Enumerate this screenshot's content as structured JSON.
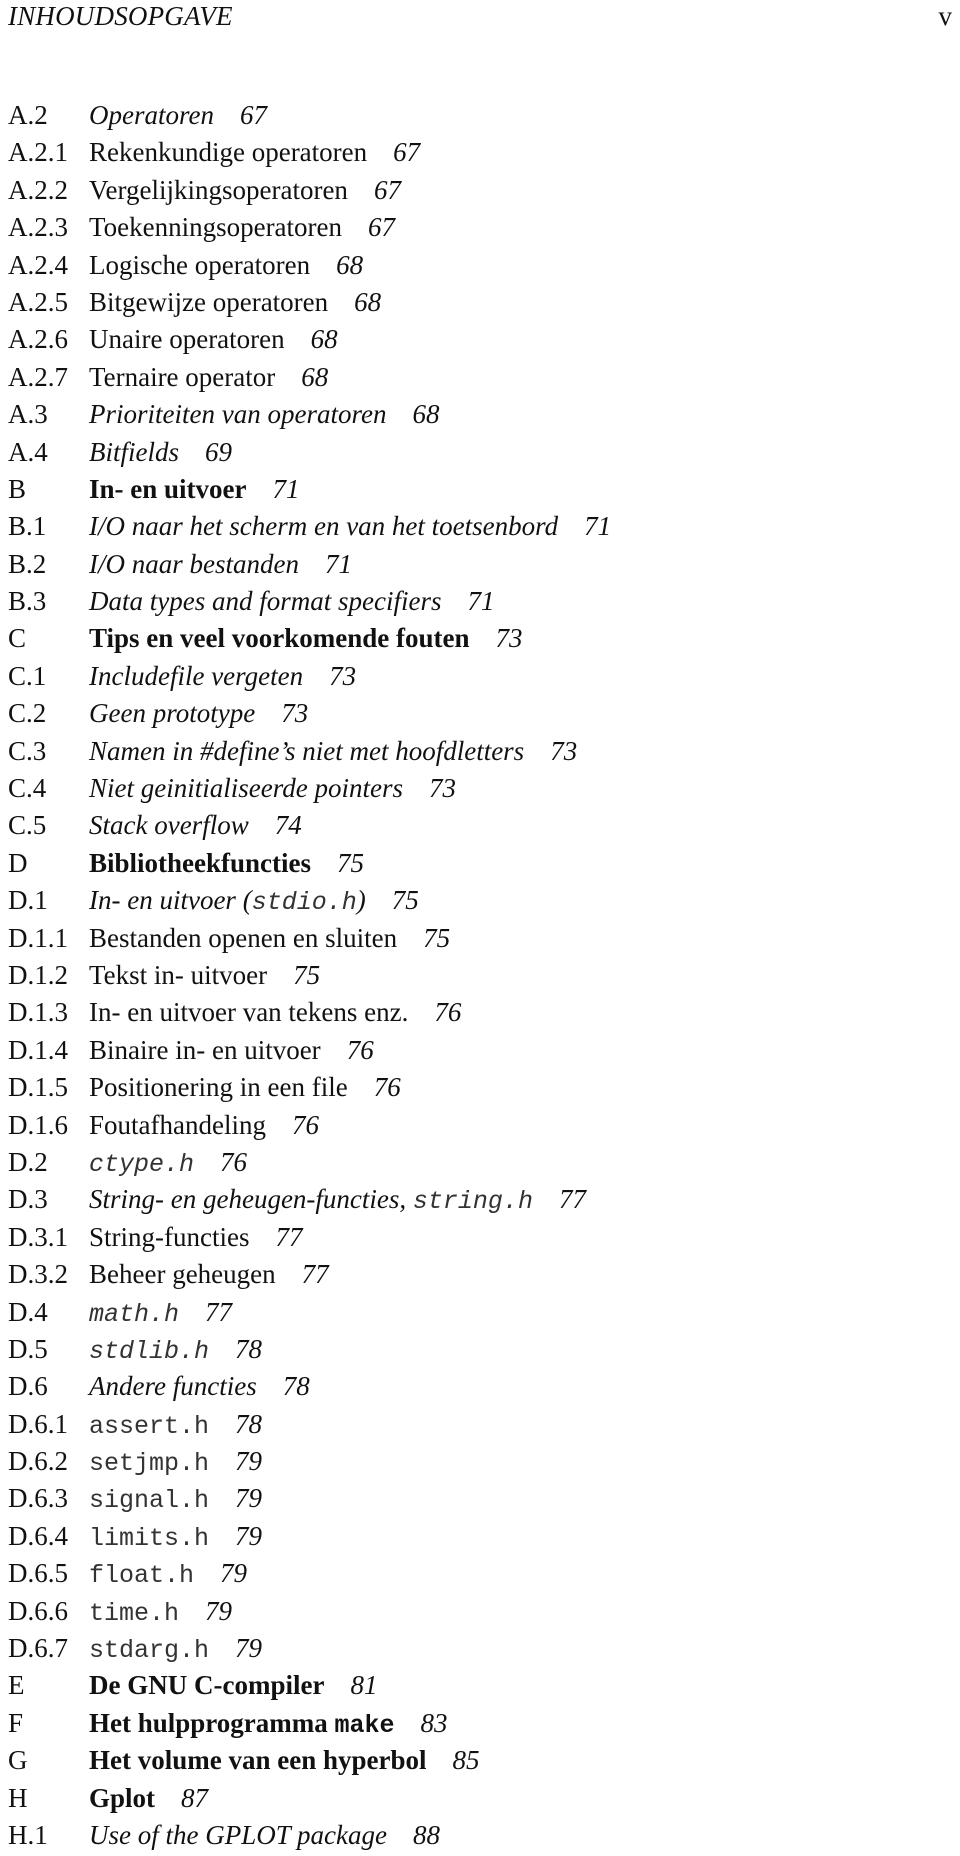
{
  "header": {
    "running_title": "INHOUDSOPGAVE",
    "page_number": "v"
  },
  "toc": [
    {
      "num": "A.2",
      "level": "section",
      "title": "Operatoren",
      "code": "",
      "suffix": "",
      "page": "67"
    },
    {
      "num": "A.2.1",
      "level": "subsection",
      "title": "Rekenkundige operatoren",
      "code": "",
      "suffix": "",
      "page": "67"
    },
    {
      "num": "A.2.2",
      "level": "subsection",
      "title": "Vergelijkingsoperatoren",
      "code": "",
      "suffix": "",
      "page": "67"
    },
    {
      "num": "A.2.3",
      "level": "subsection",
      "title": "Toekenningsoperatoren",
      "code": "",
      "suffix": "",
      "page": "67"
    },
    {
      "num": "A.2.4",
      "level": "subsection",
      "title": "Logische operatoren",
      "code": "",
      "suffix": "",
      "page": "68"
    },
    {
      "num": "A.2.5",
      "level": "subsection",
      "title": "Bitgewijze operatoren",
      "code": "",
      "suffix": "",
      "page": "68"
    },
    {
      "num": "A.2.6",
      "level": "subsection",
      "title": "Unaire operatoren",
      "code": "",
      "suffix": "",
      "page": "68"
    },
    {
      "num": "A.2.7",
      "level": "subsection",
      "title": "Ternaire operator",
      "code": "",
      "suffix": "",
      "page": "68"
    },
    {
      "num": "A.3",
      "level": "section",
      "title": "Prioriteiten van operatoren",
      "code": "",
      "suffix": "",
      "page": "68"
    },
    {
      "num": "A.4",
      "level": "section",
      "title": "Bitfields",
      "code": "",
      "suffix": "",
      "page": "69"
    },
    {
      "num": "B",
      "level": "chapter",
      "title": "In- en uitvoer",
      "code": "",
      "suffix": "",
      "page": "71"
    },
    {
      "num": "B.1",
      "level": "section",
      "title": "I/O naar het scherm en van het toetsenbord",
      "code": "",
      "suffix": "",
      "page": "71"
    },
    {
      "num": "B.2",
      "level": "section",
      "title": "I/O naar bestanden",
      "code": "",
      "suffix": "",
      "page": "71"
    },
    {
      "num": "B.3",
      "level": "section",
      "title": "Data types and format specifiers",
      "code": "",
      "suffix": "",
      "page": "71"
    },
    {
      "num": "C",
      "level": "chapter",
      "title": "Tips en veel voorkomende fouten",
      "code": "",
      "suffix": "",
      "page": "73"
    },
    {
      "num": "C.1",
      "level": "section",
      "title": "Includefile vergeten",
      "code": "",
      "suffix": "",
      "page": "73"
    },
    {
      "num": "C.2",
      "level": "section",
      "title": "Geen prototype",
      "code": "",
      "suffix": "",
      "page": "73"
    },
    {
      "num": "C.3",
      "level": "section",
      "title": "Namen in #define’s niet met hoofdletters",
      "code": "",
      "suffix": "",
      "page": "73"
    },
    {
      "num": "C.4",
      "level": "section",
      "title": "Niet geinitialiseerde pointers",
      "code": "",
      "suffix": "",
      "page": "73"
    },
    {
      "num": "C.5",
      "level": "section",
      "title": "Stack overflow",
      "code": "",
      "suffix": "",
      "page": "74"
    },
    {
      "num": "D",
      "level": "chapter",
      "title": "Bibliotheekfuncties",
      "code": "",
      "suffix": "",
      "page": "75"
    },
    {
      "num": "D.1",
      "level": "section",
      "title": "In- en uitvoer (",
      "code": "stdio.h",
      "suffix": ")",
      "page": "75"
    },
    {
      "num": "D.1.1",
      "level": "subsection",
      "title": "Bestanden openen en sluiten",
      "code": "",
      "suffix": "",
      "page": "75"
    },
    {
      "num": "D.1.2",
      "level": "subsection",
      "title": "Tekst in- uitvoer",
      "code": "",
      "suffix": "",
      "page": "75"
    },
    {
      "num": "D.1.3",
      "level": "subsection",
      "title": "In- en uitvoer van tekens enz.",
      "code": "",
      "suffix": "",
      "page": "76"
    },
    {
      "num": "D.1.4",
      "level": "subsection",
      "title": "Binaire in- en uitvoer",
      "code": "",
      "suffix": "",
      "page": "76"
    },
    {
      "num": "D.1.5",
      "level": "subsection",
      "title": "Positionering in een file",
      "code": "",
      "suffix": "",
      "page": "76"
    },
    {
      "num": "D.1.6",
      "level": "subsection",
      "title": "Foutafhandeling",
      "code": "",
      "suffix": "",
      "page": "76"
    },
    {
      "num": "D.2",
      "level": "section",
      "title": "",
      "code": "ctype.h",
      "suffix": "",
      "page": "76"
    },
    {
      "num": "D.3",
      "level": "section",
      "title": "String- en geheugen-functies, ",
      "code": "string.h",
      "suffix": "",
      "page": "77"
    },
    {
      "num": "D.3.1",
      "level": "subsection",
      "title": "String-functies",
      "code": "",
      "suffix": "",
      "page": "77"
    },
    {
      "num": "D.3.2",
      "level": "subsection",
      "title": "Beheer geheugen",
      "code": "",
      "suffix": "",
      "page": "77"
    },
    {
      "num": "D.4",
      "level": "section",
      "title": "",
      "code": "math.h",
      "suffix": "",
      "page": "77"
    },
    {
      "num": "D.5",
      "level": "section",
      "title": "",
      "code": "stdlib.h",
      "suffix": "",
      "page": "78"
    },
    {
      "num": "D.6",
      "level": "section",
      "title": "Andere functies",
      "code": "",
      "suffix": "",
      "page": "78"
    },
    {
      "num": "D.6.1",
      "level": "subsection",
      "title": "",
      "code": "assert.h",
      "suffix": "",
      "page": "78"
    },
    {
      "num": "D.6.2",
      "level": "subsection",
      "title": "",
      "code": "setjmp.h",
      "suffix": "",
      "page": "79"
    },
    {
      "num": "D.6.3",
      "level": "subsection",
      "title": "",
      "code": "signal.h",
      "suffix": "",
      "page": "79"
    },
    {
      "num": "D.6.4",
      "level": "subsection",
      "title": "",
      "code": "limits.h",
      "suffix": "",
      "page": "79"
    },
    {
      "num": "D.6.5",
      "level": "subsection",
      "title": "",
      "code": "float.h",
      "suffix": "",
      "page": "79"
    },
    {
      "num": "D.6.6",
      "level": "subsection",
      "title": "",
      "code": "time.h",
      "suffix": "",
      "page": "79"
    },
    {
      "num": "D.6.7",
      "level": "subsection",
      "title": "",
      "code": "stdarg.h",
      "suffix": "",
      "page": "79"
    },
    {
      "num": "E",
      "level": "chapter",
      "title": "De GNU C-compiler",
      "code": "",
      "suffix": "",
      "page": "81"
    },
    {
      "num": "F",
      "level": "chapter",
      "title": "Het hulpprogramma ",
      "code": "make",
      "suffix": "",
      "page": "83"
    },
    {
      "num": "G",
      "level": "chapter",
      "title": "Het volume van een hyperbol",
      "code": "",
      "suffix": "",
      "page": "85"
    },
    {
      "num": "H",
      "level": "chapter",
      "title": "Gplot",
      "code": "",
      "suffix": "",
      "page": "87"
    },
    {
      "num": "H.1",
      "level": "section",
      "title": "Use of the GPLOT package",
      "code": "",
      "suffix": "",
      "page": "88"
    }
  ]
}
